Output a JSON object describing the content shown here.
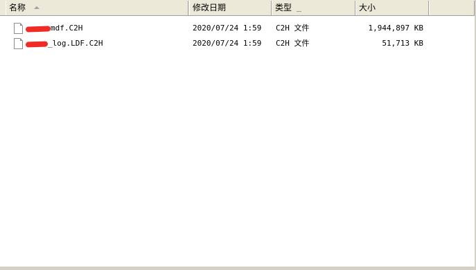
{
  "columns": {
    "name": "名称",
    "modified": "修改日期",
    "type": "类型",
    "size": "大小"
  },
  "files": [
    {
      "name_visible": "mdf.C2H",
      "modified": "2020/07/24 1:59",
      "type": "C2H 文件",
      "size": "1,944,897 KB"
    },
    {
      "name_visible": "_log.LDF.C2H",
      "modified": "2020/07/24 1:59",
      "type": "C2H 文件",
      "size": "51,713 KB"
    }
  ],
  "icons": {
    "sort": "sort-ascending-icon",
    "file": "file-icon"
  },
  "colors": {
    "redaction": "#ee2b25"
  }
}
